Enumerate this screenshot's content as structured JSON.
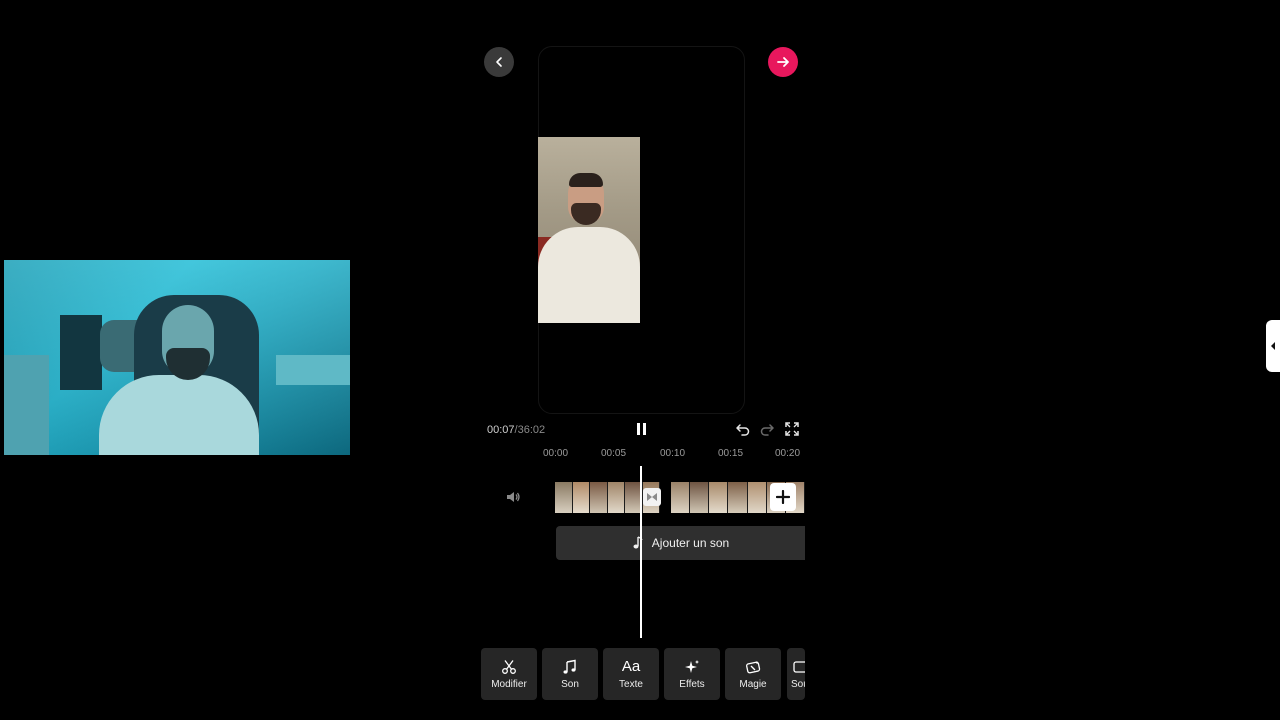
{
  "playback": {
    "current_time": "00:07",
    "separator": "/",
    "total_time": "36:02"
  },
  "ruler": {
    "ticks": [
      "00:00",
      "00:05",
      "00:10",
      "00:15",
      "00:20"
    ]
  },
  "timeline": {
    "add_sound_label": "Ajouter un son"
  },
  "toolbar": {
    "items": [
      {
        "label": "Modifier",
        "icon": "scissors-icon"
      },
      {
        "label": "Son",
        "icon": "music-note-icon"
      },
      {
        "label": "Texte",
        "icon": "text-icon",
        "glyph": "Aa"
      },
      {
        "label": "Effets",
        "icon": "sparkle-icon"
      },
      {
        "label": "Magie",
        "icon": "magic-icon"
      },
      {
        "label": "Sou",
        "icon": "subtitle-icon"
      }
    ]
  },
  "colors": {
    "accent": "#e8175d",
    "background": "#000000",
    "panel": "#262626"
  }
}
